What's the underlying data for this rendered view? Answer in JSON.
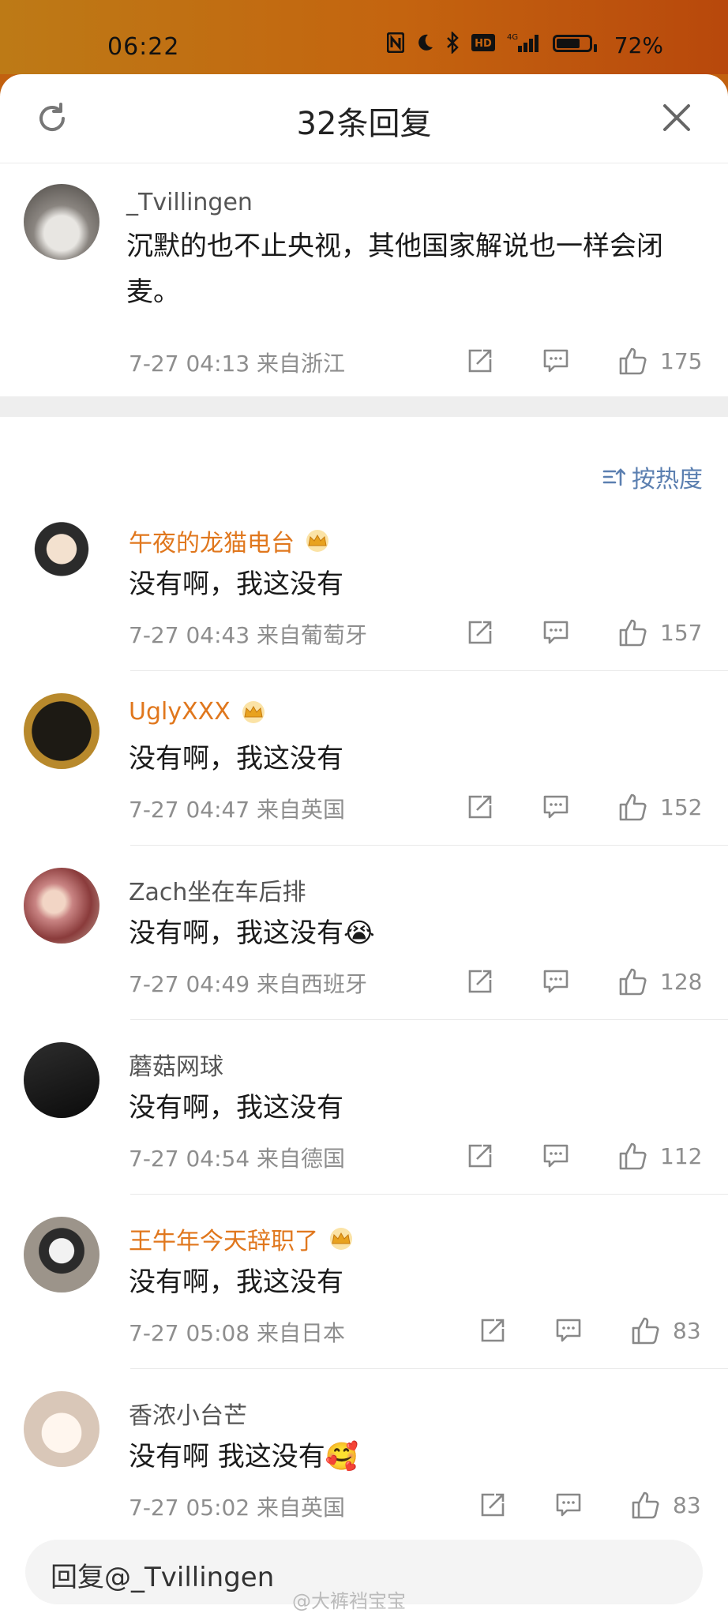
{
  "status_bar": {
    "time": "06:22",
    "battery": "72%",
    "battery_level": 0.72,
    "network": "4G"
  },
  "header": {
    "title": "32条回复"
  },
  "root_comment": {
    "user": "_Tvillingen",
    "text": "沉默的也不止央视，其他国家解说也一样会闭麦。",
    "meta": "7-27 04:13 来自浙江",
    "likes": "175"
  },
  "sort": {
    "label": "按热度"
  },
  "comments": [
    {
      "user": "午夜的龙猫电台",
      "vip": true,
      "text": "没有啊，我这没有",
      "emoji": "",
      "meta": "7-27 04:43 来自葡萄牙",
      "likes": "157"
    },
    {
      "user": "UglyXXX",
      "vip": true,
      "text": "没有啊，我这没有",
      "emoji": "",
      "meta": "7-27 04:47 来自英国",
      "likes": "152"
    },
    {
      "user": "Zach坐在车后排",
      "vip": false,
      "text": "没有啊，我这没有",
      "emoji": "😭",
      "meta": "7-27 04:49 来自西班牙",
      "likes": "128"
    },
    {
      "user": "蘑菇网球",
      "vip": false,
      "text": "没有啊，我这没有",
      "emoji": "",
      "meta": "7-27 04:54 来自德国",
      "likes": "112"
    },
    {
      "user": "王牛年今天辞职了",
      "vip": true,
      "text": "没有啊，我这没有",
      "emoji": "",
      "meta": "7-27 05:08 来自日本",
      "likes": "83"
    },
    {
      "user": "香浓小台芒",
      "vip": false,
      "text": "没有啊 我这没有",
      "emoji": "🥰",
      "meta": "7-27 05:02 来自英国",
      "likes": "83"
    }
  ],
  "reply_bar": {
    "placeholder": "回复@_Tvillingen"
  },
  "watermark": "@大裤裆宝宝",
  "colors": {
    "vip_name": "#e0771d",
    "link_blue": "#5b7fb0",
    "meta_gray": "#8e8e8e"
  }
}
